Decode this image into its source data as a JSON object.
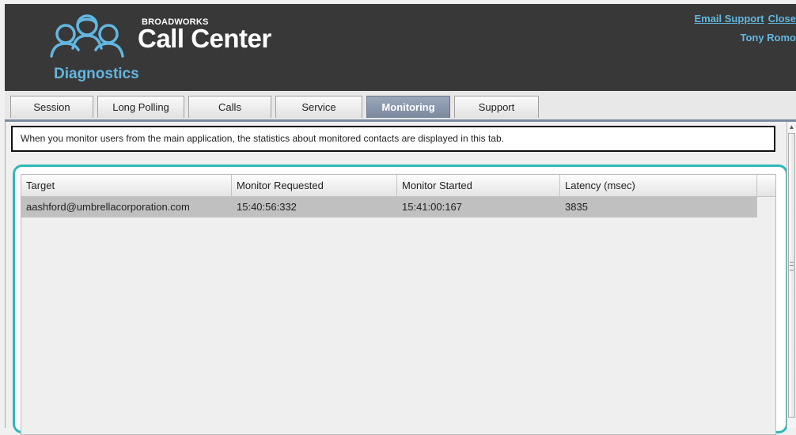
{
  "header": {
    "brand_small": "BROADWORKS",
    "brand_big": "Call Center",
    "title": "Diagnostics",
    "links": {
      "email_support": "Email Support",
      "close": "Close"
    },
    "user_name": "Tony Romo",
    "logo_icon": "agents-headset-icon",
    "colors": {
      "background": "#383838",
      "accent": "#62b7e0"
    }
  },
  "tabs": [
    {
      "label": "Session",
      "active": false
    },
    {
      "label": "Long Polling",
      "active": false
    },
    {
      "label": "Calls",
      "active": false
    },
    {
      "label": "Service",
      "active": false
    },
    {
      "label": "Monitoring",
      "active": true
    },
    {
      "label": "Support",
      "active": false
    }
  ],
  "monitoring": {
    "info": "When you monitor users from the main application, the statistics about monitored contacts are displayed in this tab.",
    "columns": [
      "Target",
      "Monitor Requested",
      "Monitor Started",
      "Latency (msec)"
    ],
    "rows": [
      [
        "aashford@umbrellacorporation.com",
        "15:40:56:332",
        "15:41:00:167",
        "3835"
      ]
    ],
    "frame_color": "#2eb8b8"
  }
}
